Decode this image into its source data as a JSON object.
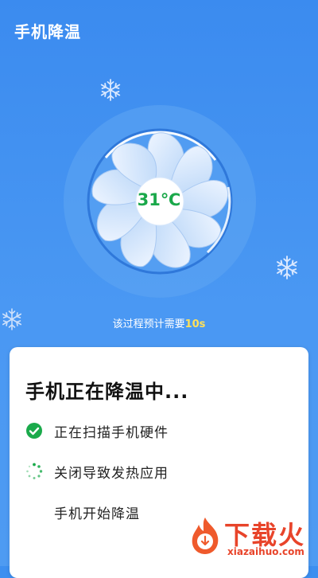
{
  "header": {
    "title": "手机降温"
  },
  "gauge": {
    "temperature": "31℃"
  },
  "estimate": {
    "prefix": "该过程预计需要",
    "seconds": "10s"
  },
  "card": {
    "title": "手机正在降温中...",
    "steps": [
      {
        "label": "正在扫描手机硬件",
        "status": "done"
      },
      {
        "label": "关闭导致发热应用",
        "status": "in-progress"
      },
      {
        "label": "手机开始降温",
        "status": "pending"
      }
    ]
  },
  "watermark": {
    "brand": "下载火",
    "url": "xiazaihuo.com"
  },
  "colors": {
    "background": "#3d8ff0",
    "temperature": "#1aa84a",
    "accent_seconds": "#ffe15a",
    "done_check": "#1aaa4b",
    "watermark": "#e8442a"
  },
  "icons": [
    "snowflake-icon",
    "fan-icon",
    "check-circle-icon",
    "loading-spinner-icon",
    "flame-logo-icon"
  ]
}
